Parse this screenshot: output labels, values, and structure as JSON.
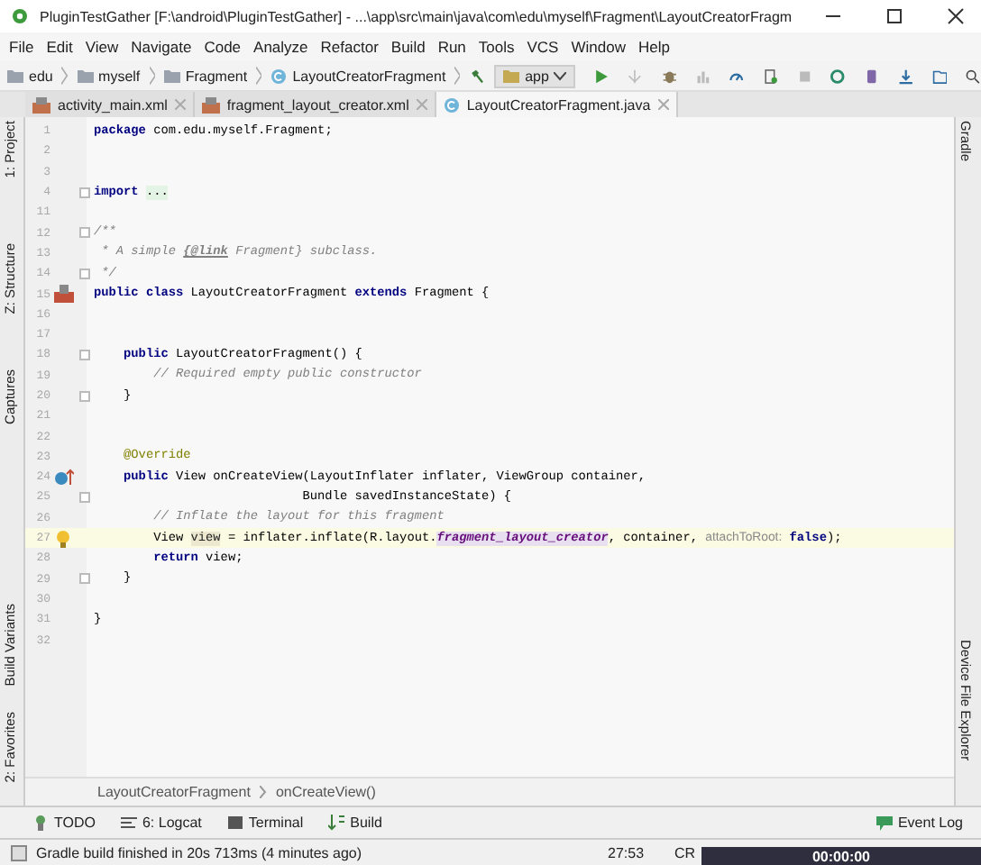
{
  "window": {
    "title": "PluginTestGather [F:\\android\\PluginTestGather] - ...\\app\\src\\main\\java\\com\\edu\\myself\\Fragment\\LayoutCreatorFragm"
  },
  "menu": [
    "File",
    "Edit",
    "View",
    "Navigate",
    "Code",
    "Analyze",
    "Refactor",
    "Build",
    "Run",
    "Tools",
    "VCS",
    "Window",
    "Help"
  ],
  "nav_bar": {
    "crumbs": [
      {
        "label": "edu",
        "kind": "folder"
      },
      {
        "label": "myself",
        "kind": "folder"
      },
      {
        "label": "Fragment",
        "kind": "folder"
      },
      {
        "label": "LayoutCreatorFragment",
        "kind": "class"
      }
    ],
    "run_config": "app"
  },
  "tabs": [
    {
      "label": "activity_main.xml",
      "kind": "xml",
      "selected": false
    },
    {
      "label": "fragment_layout_creator.xml",
      "kind": "xml",
      "selected": false
    },
    {
      "label": "LayoutCreatorFragment.java",
      "kind": "class",
      "selected": true
    }
  ],
  "left_tools": [
    "1: Project",
    "Z: Structure",
    "Captures",
    "Build Variants",
    "2: Favorites"
  ],
  "right_tools": [
    "Gradle",
    "Device File Explorer"
  ],
  "editor": {
    "lines": [
      {
        "number": "1",
        "tokens": [
          {
            "kind": "kw",
            "text": "package"
          },
          {
            "kind": "plain",
            "text": " com.edu.myself.Fragment;"
          }
        ]
      },
      {
        "number": "2"
      },
      {
        "number": "3"
      },
      {
        "number": "4",
        "fold": true,
        "tokens": [
          {
            "kind": "kw",
            "text": "import "
          },
          {
            "kind": "folded",
            "text": "..."
          }
        ]
      },
      {
        "number": "11"
      },
      {
        "number": "12",
        "fold": true,
        "tokens": [
          {
            "kind": "doc",
            "text": "/**"
          }
        ]
      },
      {
        "number": "13",
        "tokens": [
          {
            "kind": "doc",
            "text": " * A simple "
          },
          {
            "kind": "doclink",
            "text": "{@link"
          },
          {
            "kind": "doc",
            "text": " Fragment} subclass."
          }
        ]
      },
      {
        "number": "14",
        "fold": true,
        "tokens": [
          {
            "kind": "doc",
            "text": " */"
          }
        ]
      },
      {
        "number": "15",
        "kind": "class",
        "tokens": [
          {
            "kind": "kw",
            "text": "public class"
          },
          {
            "kind": "plain",
            "text": " LayoutCreatorFragment "
          },
          {
            "kind": "kw",
            "text": "extends"
          },
          {
            "kind": "plain",
            "text": " Fragment {"
          }
        ]
      },
      {
        "number": "16"
      },
      {
        "number": "17"
      },
      {
        "number": "18",
        "fold": true,
        "tokens": [
          {
            "kind": "kw",
            "text": "    public"
          },
          {
            "kind": "plain",
            "text": " LayoutCreatorFragment() {"
          }
        ]
      },
      {
        "number": "19",
        "tokens": [
          {
            "kind": "comment",
            "text": "        // Required empty public constructor"
          }
        ]
      },
      {
        "number": "20",
        "fold": true,
        "tokens": [
          {
            "kind": "plain",
            "text": "    }"
          }
        ]
      },
      {
        "number": "21"
      },
      {
        "number": "22"
      },
      {
        "number": "23",
        "tokens": [
          {
            "kind": "annotation",
            "text": "    @Override"
          }
        ]
      },
      {
        "number": "24",
        "kind": "override",
        "tokens": [
          {
            "kind": "kw",
            "text": "    public"
          },
          {
            "kind": "plain",
            "text": " View onCreateView(LayoutInflater inflater, ViewGroup container,"
          }
        ]
      },
      {
        "number": "25",
        "fold": true,
        "tokens": [
          {
            "kind": "plain",
            "text": "                            Bundle savedInstanceState) {"
          }
        ]
      },
      {
        "number": "26",
        "tokens": [
          {
            "kind": "comment",
            "text": "        // Inflate the layout for this fragment"
          }
        ]
      },
      {
        "number": "27",
        "kind": "bulb",
        "current": true,
        "tokens": [
          {
            "kind": "plain",
            "text": "        View "
          },
          {
            "kind": "var",
            "text": "view"
          },
          {
            "kind": "plain",
            "text": " = inflater.inflate(R.layout."
          },
          {
            "kind": "field",
            "text": "fragment_layout_creator"
          },
          {
            "kind": "plain",
            "text": ", container, "
          },
          {
            "kind": "hint",
            "text": "attachToRoot:"
          },
          {
            "kind": "kw",
            "text": " false"
          },
          {
            "kind": "plain",
            "text": ");"
          }
        ]
      },
      {
        "number": "28",
        "tokens": [
          {
            "kind": "kw",
            "text": "        return"
          },
          {
            "kind": "plain",
            "text": " view;"
          }
        ]
      },
      {
        "number": "29",
        "fold": true,
        "tokens": [
          {
            "kind": "plain",
            "text": "    }"
          }
        ]
      },
      {
        "number": "30"
      },
      {
        "number": "31",
        "tokens": [
          {
            "kind": "plain",
            "text": "}"
          }
        ]
      },
      {
        "number": "32"
      }
    ],
    "breadcrumb": [
      "LayoutCreatorFragment",
      "onCreateView()"
    ]
  },
  "tool_windows": [
    {
      "label": "TODO",
      "kind": "todo"
    },
    {
      "label": "6: Logcat",
      "kind": "logcat"
    },
    {
      "label": "Terminal",
      "kind": "terminal"
    },
    {
      "label": "Build",
      "kind": "build"
    }
  ],
  "event_log": "Event Log",
  "status_bar": {
    "message": "Gradle build finished in 20s 713ms (4 minutes ago)",
    "position": "27:53",
    "line_separator": "CR"
  },
  "recorder": {
    "time": "00:00:00"
  }
}
